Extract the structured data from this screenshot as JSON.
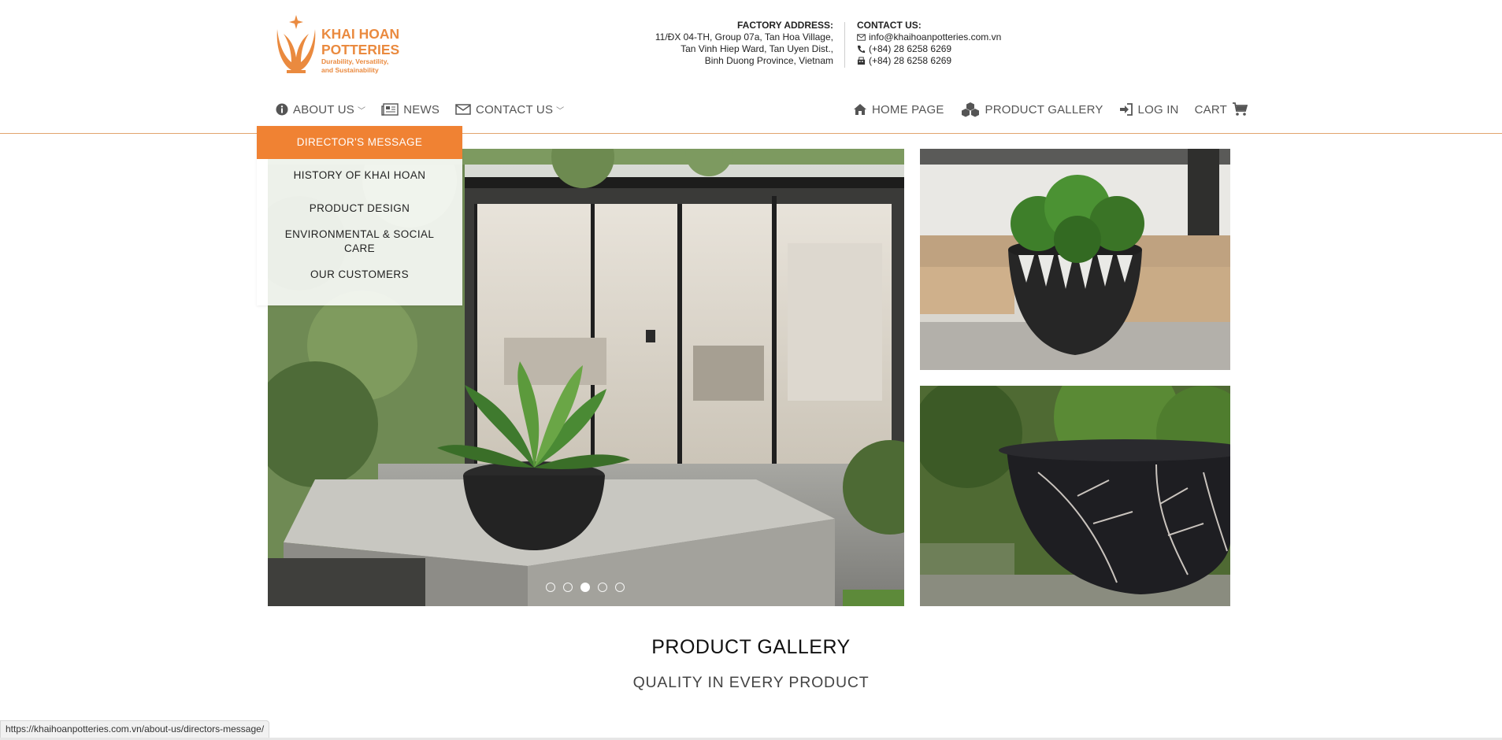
{
  "brand": {
    "title_line1": "KHAI HOAN",
    "title_line2": "POTTERIES",
    "tagline_line1": "Durability, Versatility,",
    "tagline_line2": "and Sustainability",
    "color": "#ea8a3f"
  },
  "factory": {
    "heading": "FACTORY ADDRESS:",
    "line1": "11/ĐX 04-TH, Group 07a, Tan Hoa Village,",
    "line2": "Tan Vinh Hiep Ward, Tan Uyen Dist.,",
    "line3": "Binh Duong Province, Vietnam"
  },
  "contact": {
    "heading": "CONTACT US:",
    "email": "info@khaihoanpotteries.com.vn",
    "phone": "(+84) 28 6258 6269",
    "fax": "(+84) 28 6258 6269"
  },
  "nav_left": {
    "about": "ABOUT US",
    "news": "NEWS",
    "contact": "CONTACT US"
  },
  "nav_right": {
    "home": "HOME PAGE",
    "gallery": "PRODUCT GALLERY",
    "login": "LOG IN",
    "cart": "CART"
  },
  "dropdown": {
    "items": [
      "DIRECTOR'S MESSAGE",
      "HISTORY OF KHAI HOAN",
      "PRODUCT DESIGN",
      "ENVIRONMENTAL & SOCIAL CARE",
      "OUR CUSTOMERS"
    ]
  },
  "slider": {
    "active_index": 3,
    "count": 5
  },
  "section": {
    "title": "PRODUCT GALLERY",
    "subtitle": "QUALITY IN EVERY PRODUCT"
  },
  "status_bar": {
    "url": "https://khaihoanpotteries.com.vn/about-us/directors-message/"
  },
  "colors": {
    "accent": "#f08233",
    "nav_line": "#e2a56e"
  }
}
